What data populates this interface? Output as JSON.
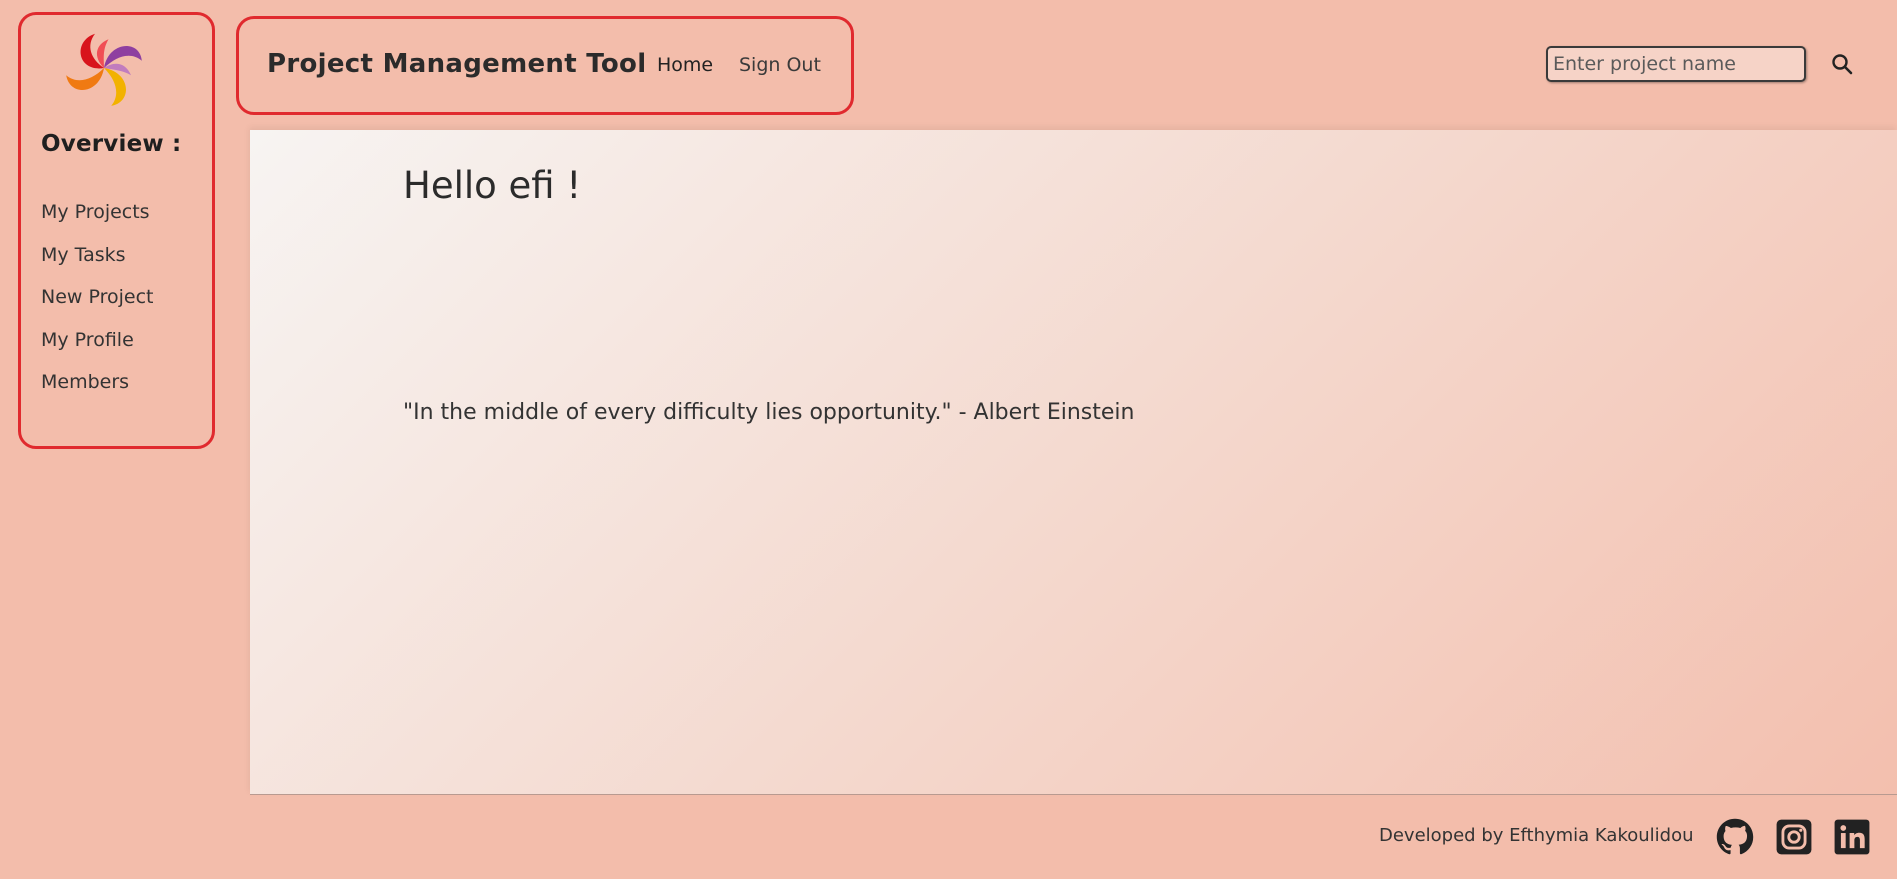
{
  "sidebar": {
    "heading": "Overview :",
    "items": [
      {
        "label": "My Projects"
      },
      {
        "label": "My Tasks"
      },
      {
        "label": "New Project"
      },
      {
        "label": "My Profile"
      },
      {
        "label": "Members"
      }
    ]
  },
  "header": {
    "brand": "Project Management Tool",
    "nav": {
      "home": "Home",
      "sign_out": "Sign Out"
    },
    "search": {
      "placeholder": "Enter project name",
      "icon": "search-icon"
    }
  },
  "main": {
    "greeting": "Hello efi !",
    "quote": "\"In the middle of every difficulty lies opportunity.\" - Albert Einstein"
  },
  "footer": {
    "credit": "Developed by Efthymia Kakoulidou",
    "icons": [
      "github-icon",
      "instagram-icon",
      "linkedin-icon"
    ]
  },
  "colors": {
    "background": "#f3bdab",
    "highlight_border": "#e02a2e",
    "text": "#2b2b2b"
  }
}
